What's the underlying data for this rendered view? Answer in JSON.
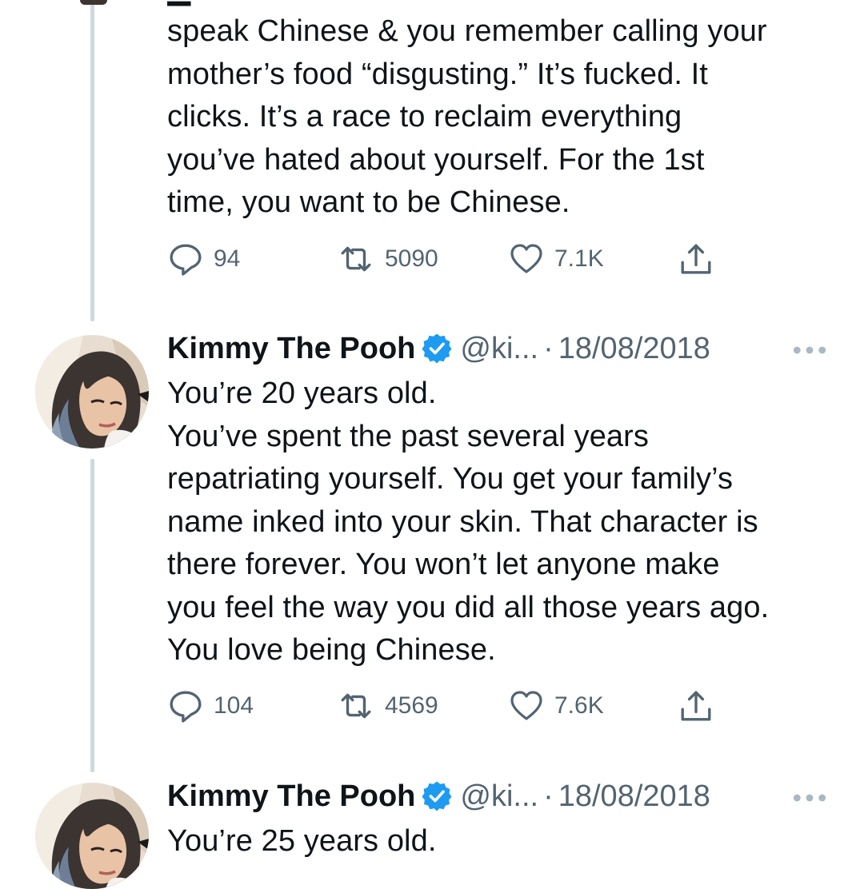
{
  "tweets": [
    {
      "text": "speak Chinese & you remember calling your\nmother’s food “disgusting.” It’s fucked. It\nclicks. It’s a race to reclaim everything\nyou’ve hated about yourself. For the 1st\ntime, you want to be Chinese.",
      "replies": "94",
      "retweets": "5090",
      "likes": "7.1K"
    },
    {
      "display_name": "Kimmy The Pooh",
      "handle": "@ki...",
      "separator": "·",
      "date": "18/08/2018",
      "text": "You’re 20 years old.\nYou’ve spent the past several years\nrepatriating yourself. You get your family’s\nname inked into your skin. That character is\nthere forever. You won’t let anyone make\nyou feel the way you did all those years ago.\nYou love being Chinese.",
      "replies": "104",
      "retweets": "4569",
      "likes": "7.6K"
    },
    {
      "display_name": "Kimmy The Pooh",
      "handle": "@ki...",
      "separator": "·",
      "date": "18/08/2018",
      "text": "You’re 25 years old."
    }
  ],
  "icons": {
    "reply": "reply-icon",
    "retweet": "retweet-icon",
    "like": "heart-icon",
    "share": "share-icon",
    "verified": "verified-badge-icon",
    "more": "more-icon"
  },
  "colors": {
    "text": "#0f1419",
    "secondary": "#536471",
    "verified": "#1d9bf0",
    "thread_line": "#cfd9de"
  }
}
